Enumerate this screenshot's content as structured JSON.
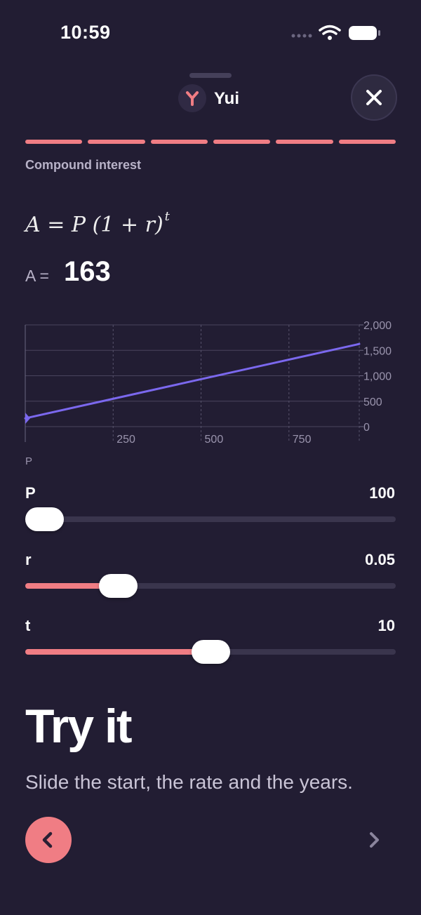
{
  "status_bar": {
    "time": "10:59"
  },
  "header": {
    "app_name": "Yui",
    "close_icon": "close-icon",
    "logo_icon": "y-logo-icon"
  },
  "progress": {
    "segments": 6,
    "completed": 6,
    "accent": "#f07d84"
  },
  "lesson": {
    "title": "Compound interest"
  },
  "formula": {
    "lhs": "A",
    "eq": " = ",
    "p": "P",
    "base": "(1 + r)",
    "exp": "t"
  },
  "result": {
    "label": "A =",
    "value": "163"
  },
  "chart_data": {
    "type": "line",
    "xlabel": "P",
    "ylabel": "",
    "xlim": [
      0,
      950
    ],
    "ylim": [
      0,
      2000
    ],
    "x_ticks": [
      250,
      500,
      750
    ],
    "x_tick_labels": [
      "250",
      "500",
      "750"
    ],
    "y_ticks": [
      0,
      500,
      1000,
      1500,
      2000
    ],
    "y_tick_labels": [
      "0",
      "500",
      "1,000",
      "1,500",
      "2,000"
    ],
    "grid": true,
    "y_axis_side": "right",
    "line_color": "#7b68ee",
    "series": [
      {
        "x": [
          0,
          950
        ],
        "y": [
          163,
          1625
        ]
      }
    ],
    "marker": {
      "x": 0,
      "y": 163
    }
  },
  "sliders": [
    {
      "name": "P",
      "value": "100",
      "fraction": 0.0
    },
    {
      "name": "r",
      "value": "0.05",
      "fraction": 0.25
    },
    {
      "name": "t",
      "value": "10",
      "fraction": 0.5
    }
  ],
  "content": {
    "heading": "Try it",
    "subtitle": "Slide the start, the rate and the years."
  },
  "nav": {
    "prev_icon": "chevron-left-icon",
    "next_icon": "chevron-right-icon"
  },
  "colors": {
    "background": "#221d33",
    "accent": "#f07d84",
    "line": "#7b68ee"
  }
}
